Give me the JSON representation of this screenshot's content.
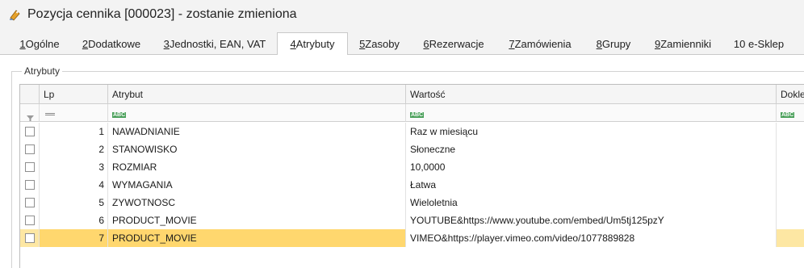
{
  "window": {
    "title": "Pozycja cennika [000023] - zostanie zmieniona"
  },
  "tabs": [
    {
      "hotkey": "1",
      "label": " Ogólne"
    },
    {
      "hotkey": "2",
      "label": " Dodatkowe"
    },
    {
      "hotkey": "3",
      "label": " Jednostki, EAN, VAT"
    },
    {
      "hotkey": "4",
      "label": " Atrybuty"
    },
    {
      "hotkey": "5",
      "label": " Zasoby"
    },
    {
      "hotkey": "6",
      "label": " Rezerwacje"
    },
    {
      "hotkey": "7",
      "label": " Zamówienia"
    },
    {
      "hotkey": "8",
      "label": " Grupy"
    },
    {
      "hotkey": "9",
      "label": " Zamienniki"
    },
    {
      "hotkey": "",
      "label": "10 e-Sklep"
    }
  ],
  "active_tab": "4 Atrybuty",
  "group": {
    "label": "Atrybuty"
  },
  "grid": {
    "headers": {
      "lp": "Lp",
      "attribute": "Atrybut",
      "value": "Wartość",
      "attach": "Doklejać do"
    },
    "filter_hint": "ABC",
    "rows": [
      {
        "lp": "1",
        "attribute": "NAWADNIANIE",
        "value": "Raz w miesiącu"
      },
      {
        "lp": "2",
        "attribute": "STANOWISKO",
        "value": "Słoneczne"
      },
      {
        "lp": "3",
        "attribute": "ROZMIAR",
        "value": "10,0000"
      },
      {
        "lp": "4",
        "attribute": "WYMAGANIA",
        "value": "Łatwa"
      },
      {
        "lp": "5",
        "attribute": "ZYWOTNOSC",
        "value": "Wieloletnia"
      },
      {
        "lp": "6",
        "attribute": "PRODUCT_MOVIE",
        "value": "YOUTUBE&https://www.youtube.com/embed/Um5tj125pzY"
      },
      {
        "lp": "7",
        "attribute": "PRODUCT_MOVIE",
        "value": "VIMEO&https://player.vimeo.com/video/1077889828"
      }
    ],
    "selected_row": "7"
  },
  "colors": {
    "selected_row": "#fde7a3",
    "selected_cell": "#ffd76e",
    "abc_icon": "#4aa05a"
  }
}
